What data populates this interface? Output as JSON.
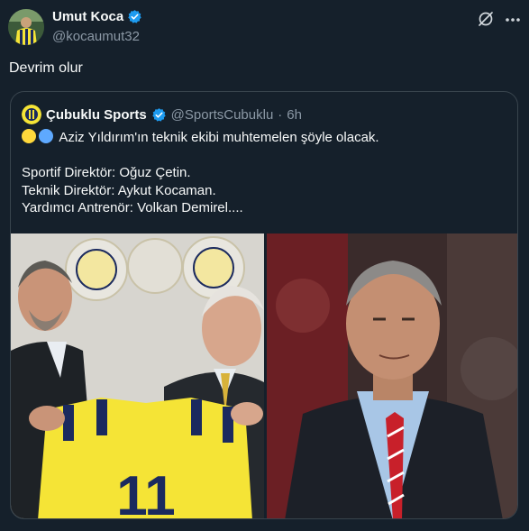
{
  "tweet": {
    "author": {
      "display_name": "Umut Koca",
      "handle": "@kocaumut32",
      "verified": true,
      "avatar_icon": "avatar-fenerbahce-icon"
    },
    "text": "Devrim olur",
    "actions": {
      "grok_icon": "grok-slash-icon",
      "more_icon": "more-dots-icon"
    }
  },
  "quote": {
    "author": {
      "display_name": "Çubuklu Sports",
      "handle": "@SportsCubuklu",
      "separator": "·",
      "time": "6h",
      "verified": true
    },
    "lines": [
      "Aziz Yıldırım'ın teknik ekibi muhtemelen şöyle olacak.",
      "",
      "Sportif Direktör: Oğuz Çetin.",
      "Teknik Direktör: Aykut Kocaman.",
      "Yardımcı Antrenör: Volkan Demirel...."
    ],
    "emoji": [
      "yellow-circle",
      "blue-circle"
    ],
    "media": [
      {
        "name": "photo-kocaman-yildirim",
        "jersey_number": "11"
      },
      {
        "name": "photo-oguz-cetin"
      }
    ]
  },
  "colors": {
    "background": "#15202b",
    "text_primary": "#f7f9f9",
    "text_secondary": "#8b98a5",
    "border": "#38444d",
    "verified_blue": "#1d9bf0",
    "jersey_yellow": "#f5e436",
    "jersey_navy": "#1b2a5e"
  }
}
